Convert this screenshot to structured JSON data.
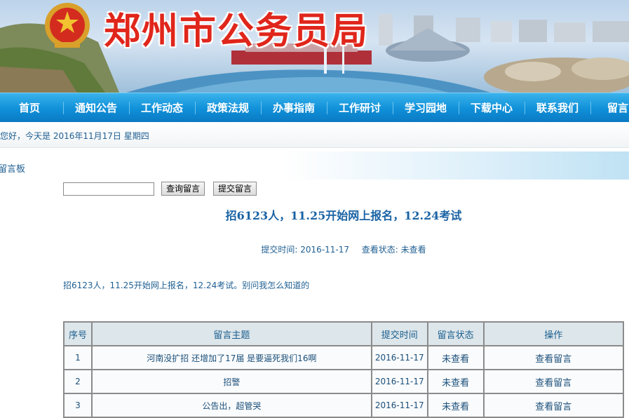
{
  "site": {
    "title": "郑州市公务员局"
  },
  "nav": {
    "items": [
      "首页",
      "通知公告",
      "工作动态",
      "政策法规",
      "办事指南",
      "工作研讨",
      "学习园地",
      "下载中心",
      "联系我们",
      "留言"
    ]
  },
  "greeting": {
    "text": "您好，今天是 2016年11月17日 星期四"
  },
  "board": {
    "heading": "留言板"
  },
  "search": {
    "value": "",
    "query_button": "查询留言",
    "submit_button": "提交留言"
  },
  "message": {
    "title": "招6123人，11.25开始网上报名，12.24考试",
    "submit_time_label": "提交时间:",
    "submit_time": "2016-11-17",
    "status_label": "查看状态:",
    "status": "未查看",
    "body": "招6123人，11.25开始网上报名，12.24考试。别问我怎么知道的"
  },
  "table": {
    "headers": [
      "序号",
      "留言主题",
      "提交时间",
      "留言状态",
      "操作"
    ],
    "rows": [
      {
        "no": "1",
        "subject": "河南没扩招 还增加了17届 是要逼死我们16啊",
        "time": "2016-11-17",
        "status": "未查看",
        "action": "查看留言"
      },
      {
        "no": "2",
        "subject": "招警",
        "time": "2016-11-17",
        "status": "未查看",
        "action": "查看留言"
      },
      {
        "no": "3",
        "subject": "公告出，超管哭",
        "time": "2016-11-17",
        "status": "未查看",
        "action": "查看留言"
      }
    ]
  },
  "colors": {
    "nav_blue": "#0f8fd8",
    "title_red": "#e0261b",
    "link_blue": "#1a63a4"
  }
}
